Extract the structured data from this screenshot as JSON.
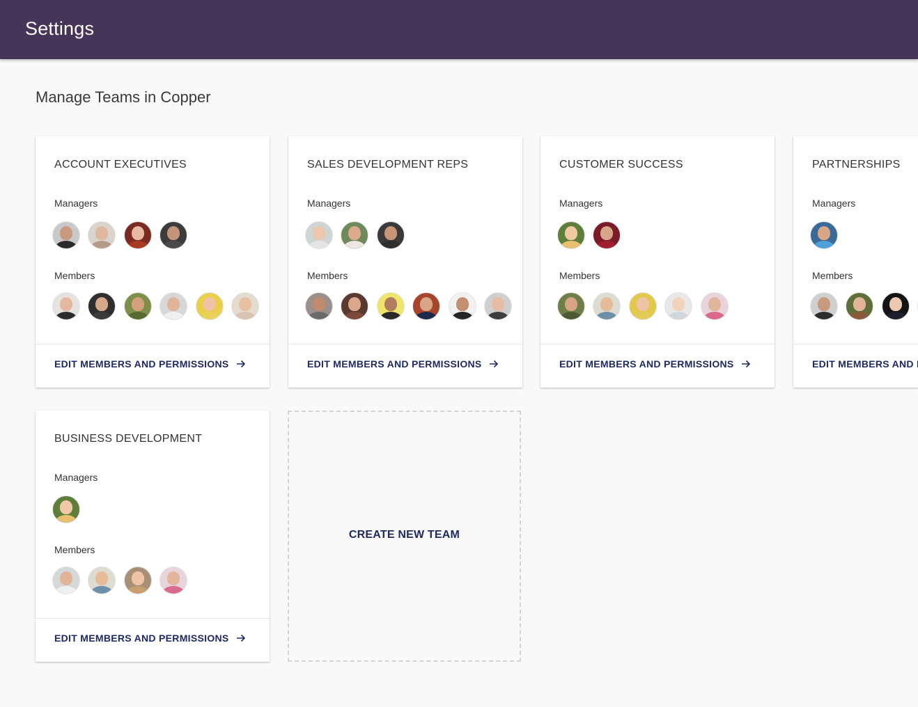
{
  "header": {
    "title": "Settings"
  },
  "page": {
    "title": "Manage Teams in Copper"
  },
  "labels": {
    "managers": "Managers",
    "members": "Members",
    "edit_action": "EDIT MEMBERS AND PERMISSIONS",
    "create_team": "CREATE NEW TEAM"
  },
  "colors": {
    "header_bg": "#463459",
    "accent_text": "#1e2a60",
    "page_bg": "#f9f9f9"
  },
  "teams": [
    {
      "name": "ACCOUNT EXECUTIVES",
      "managers_count": 4,
      "members_count": 6
    },
    {
      "name": "SALES DEVELOPMENT REPS",
      "managers_count": 3,
      "members_count": 6
    },
    {
      "name": "CUSTOMER SUCCESS",
      "managers_count": 2,
      "members_count": 5
    },
    {
      "name": "PARTNERSHIPS",
      "managers_count": 1,
      "members_count": 4
    },
    {
      "name": "BUSINESS DEVELOPMENT",
      "managers_count": 1,
      "members_count": 4
    }
  ]
}
